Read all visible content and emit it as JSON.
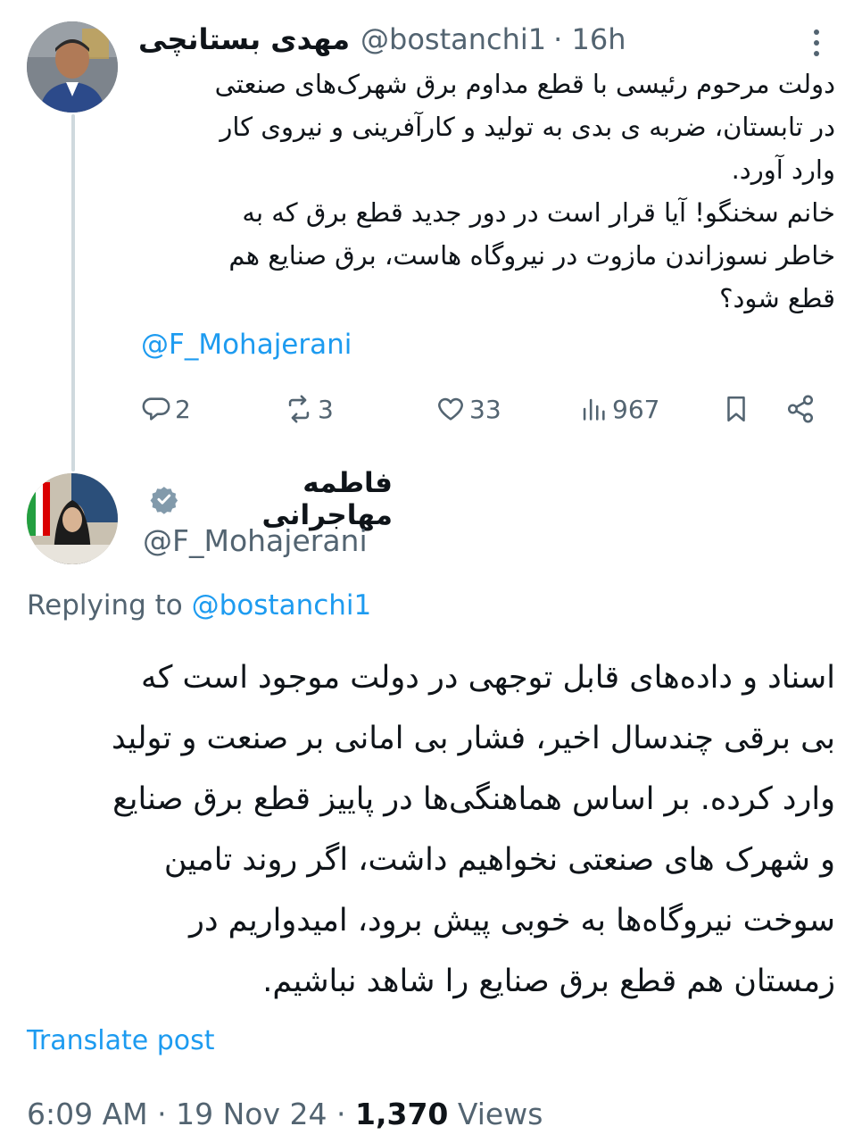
{
  "tweet1": {
    "display_name": "مهدی بستانچی",
    "handle": "@bostanchi1",
    "time": "· 16h",
    "text_lines": [
      "دولت مرحوم رئیسی با قطع مداوم برق شهرک‌های صنعتی",
      "در تابستان، ضربه ی بدی به تولید و کارآفرینی و نیروی کار",
      "وارد آورد.",
      "خانم سخنگو! آیا قرار است در دور جدید قطع برق که به",
      "خاطر نسوزاندن مازوت در نیروگاه هاست، برق صنایع هم",
      "قطع شود؟"
    ],
    "mention": "@F_Mohajerani",
    "replies": "2",
    "reposts": "3",
    "likes": "33",
    "views": "967"
  },
  "tweet2": {
    "display_name": "فاطمه مهاجرانی",
    "handle": "@F_Mohajerani",
    "replying_prefix": "Replying to",
    "replying_to": "@bostanchi1",
    "text_lines": [
      "اسناد و داده‌های قابل توجهی در دولت موجود است که",
      "بی برقی چندسال اخیر، فشار بی امانی بر صنعت و تولید",
      "وارد کرده. بر اساس هماهنگی‌ها در پاییز قطع برق صنایع",
      "و شهرک های صنعتی نخواهیم داشت، اگر روند تامین",
      "سوخت نیروگاه‌ها به خوبی پیش برود، امیدواریم در",
      "زمستان هم قطع برق صنایع را شاهد نباشیم."
    ],
    "translate_label": "Translate post",
    "time": "6:09 AM",
    "date": "19 Nov 24",
    "views_count": "1,370",
    "views_label": "Views"
  },
  "colors": {
    "accent": "#1d9bf0",
    "secondary_text": "#536471",
    "primary_text": "#0f1419",
    "thread_line": "#cfd9de"
  },
  "icons": [
    "more-vertical-icon",
    "reply-icon",
    "repost-icon",
    "like-icon",
    "views-icon",
    "bookmark-icon",
    "share-icon",
    "verified-badge-icon"
  ]
}
